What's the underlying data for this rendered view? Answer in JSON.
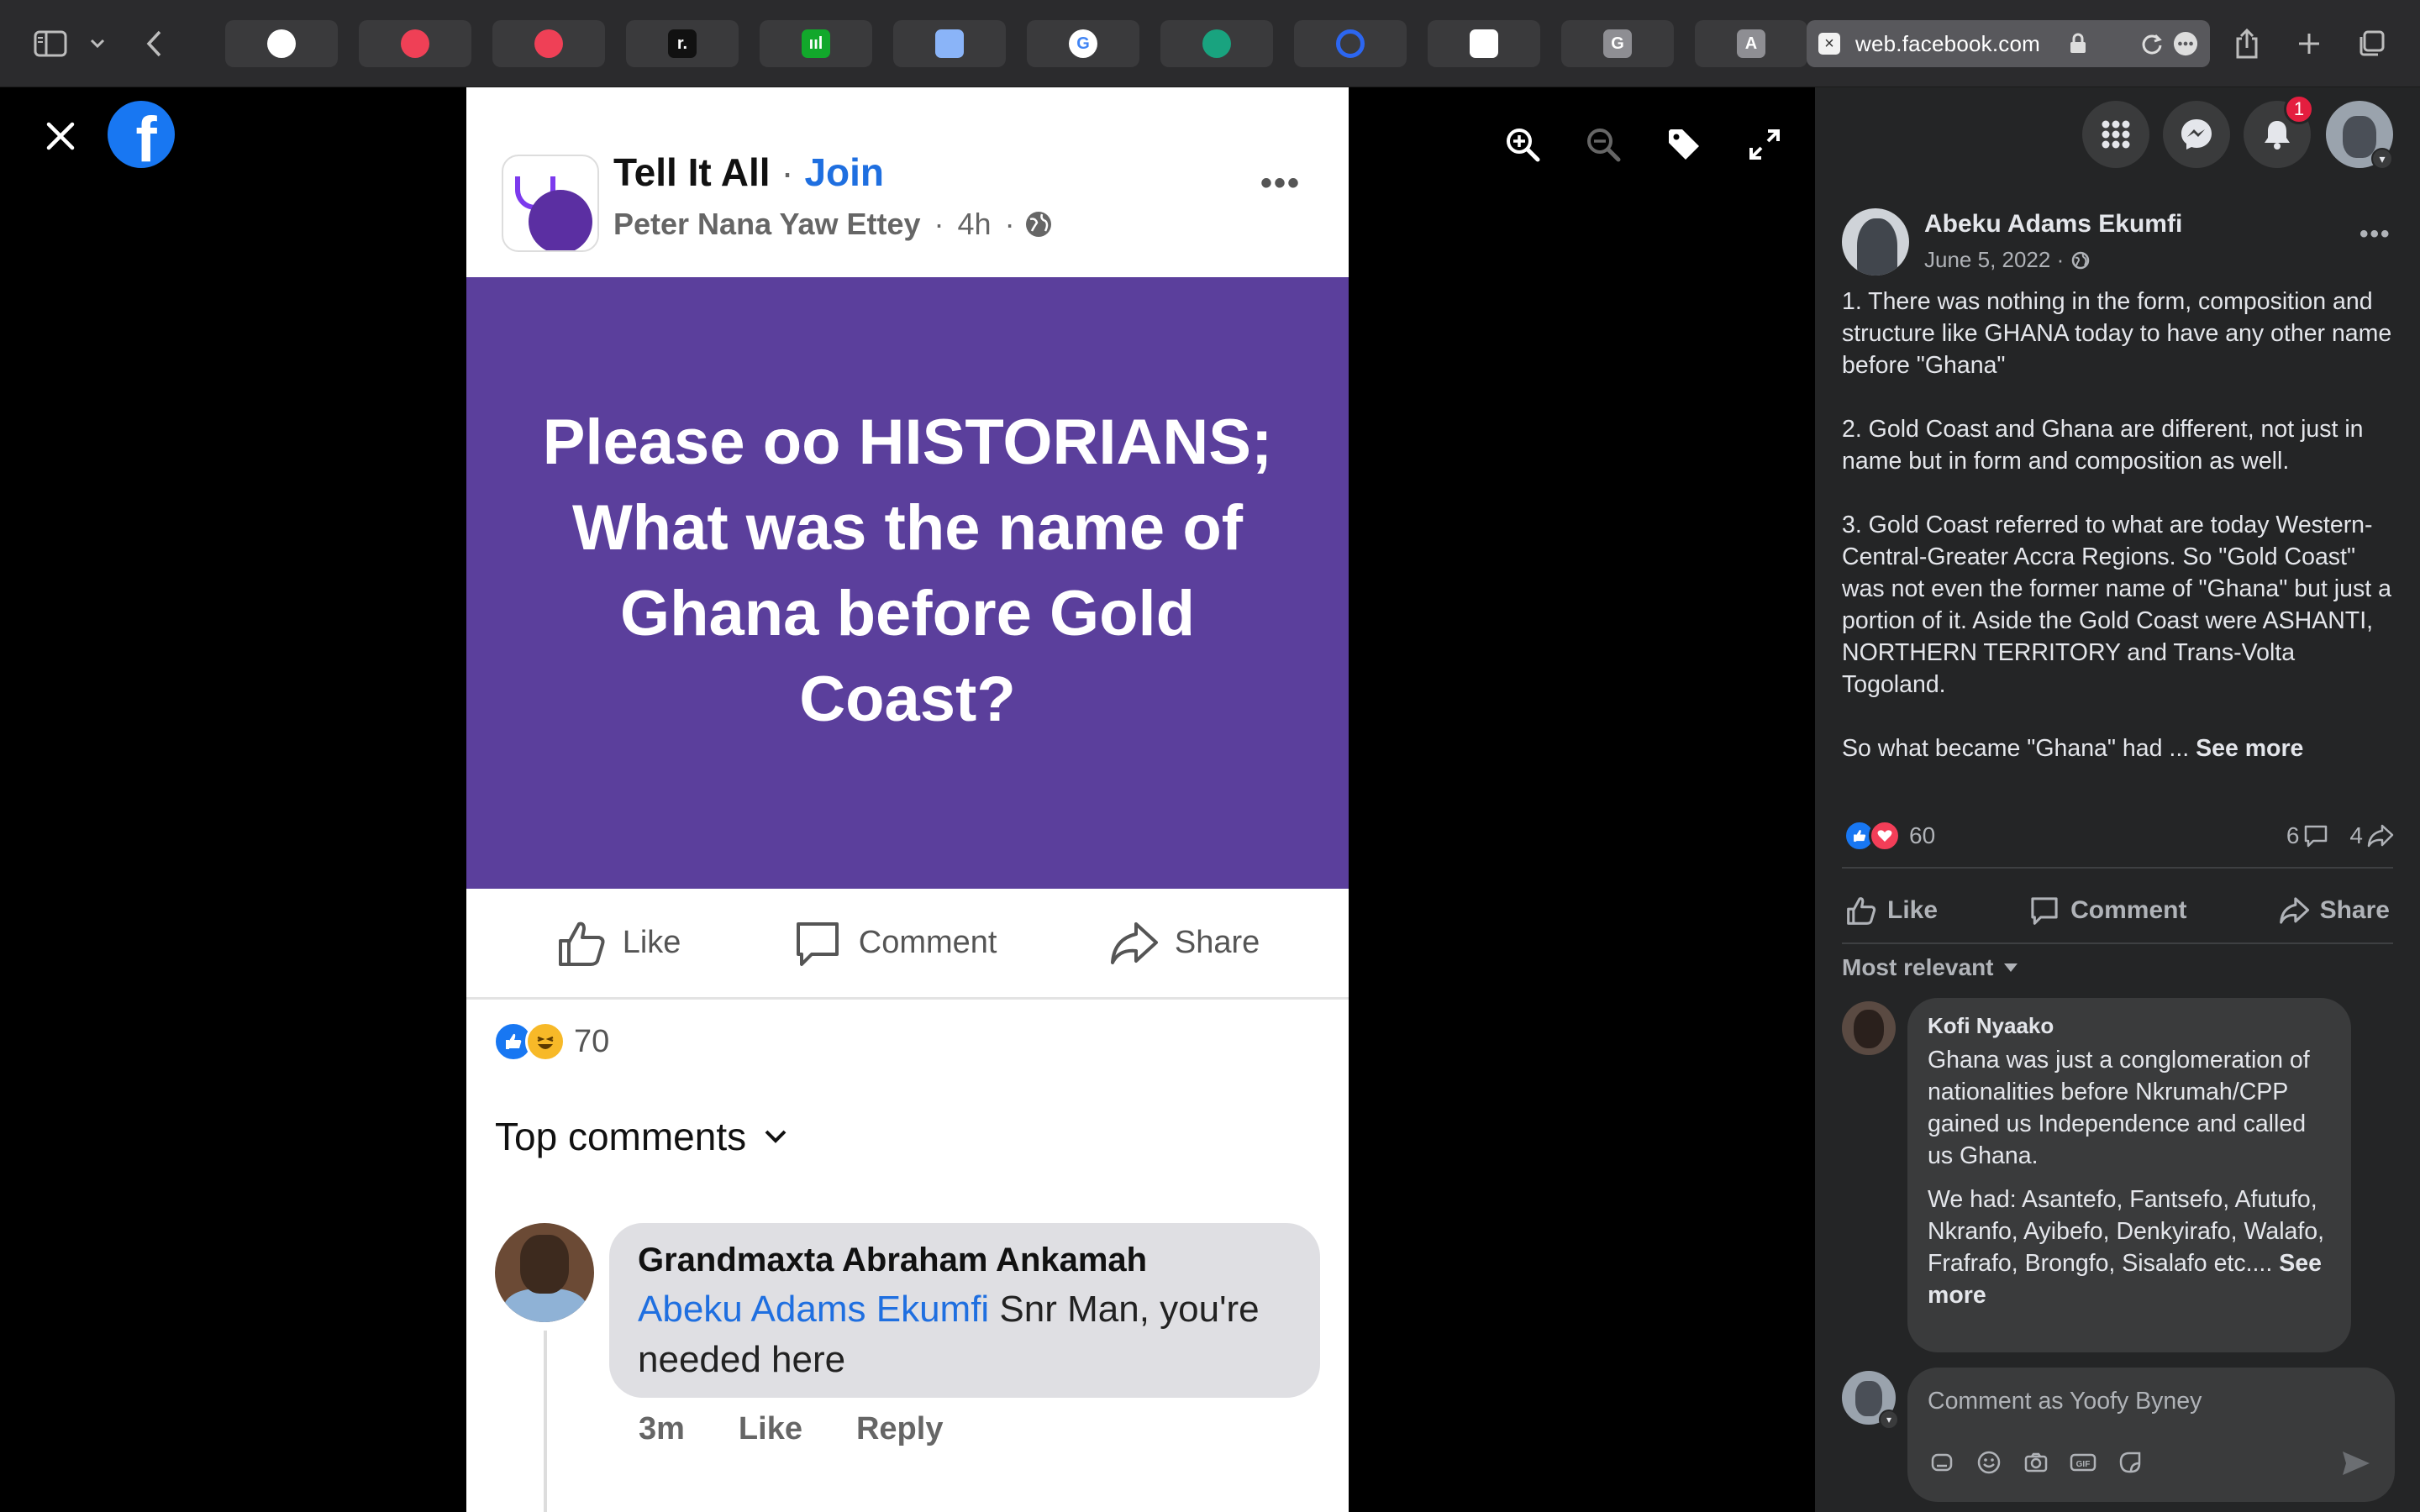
{
  "browser": {
    "url": "web.facebook.com",
    "tabs": [
      {
        "icon": "github-icon",
        "glyph": "",
        "color": "#ffffff"
      },
      {
        "icon": "pocket-icon",
        "glyph": "",
        "color": "#ef4056"
      },
      {
        "icon": "pocket-icon",
        "glyph": "",
        "color": "#ef4056"
      },
      {
        "icon": "readwise-icon",
        "glyph": "r.",
        "color": "#111111"
      },
      {
        "icon": "app-icon",
        "glyph": "ııl",
        "color": "#12a82b"
      },
      {
        "icon": "chat-bubble-icon",
        "glyph": "",
        "color": "#8ab4f8"
      },
      {
        "icon": "google-icon",
        "glyph": "G",
        "color": "#ffffff"
      },
      {
        "icon": "openai-icon",
        "glyph": "",
        "color": "#19a37f"
      },
      {
        "icon": "ring-icon",
        "glyph": "",
        "color": "#2c66f0"
      },
      {
        "icon": "institution-icon",
        "glyph": "",
        "color": "#ffffff"
      },
      {
        "icon": "letter-g-icon",
        "glyph": "G",
        "color": "#8e8e93"
      },
      {
        "icon": "letter-a-icon",
        "glyph": "A",
        "color": "#8e8e93"
      },
      {
        "icon": "whatsapp-icon",
        "glyph": "",
        "color": "#25d366"
      }
    ]
  },
  "photo": {
    "group_name": "Tell It All",
    "join_label": "Join",
    "author": "Peter Nana Yaw Ettey",
    "time": "4h",
    "headline": "Please oo HISTORIANS; What was the name of Ghana before Gold Coast?",
    "like_label": "Like",
    "comment_label": "Comment",
    "share_label": "Share",
    "reaction_count": "70",
    "top_comments_label": "Top comments",
    "comment": {
      "author": "Grandmaxta Abraham Ankamah",
      "mention": "Abeku Adams Ekumfi",
      "text": " Snr Man, you're needed here",
      "time": "3m",
      "like": "Like",
      "reply": "Reply"
    }
  },
  "panel": {
    "notifications_count": "1",
    "author": "Abeku Adams Ekumfi",
    "date": "June 5, 2022 ·",
    "paragraphs": [
      "1. There was nothing in the form, composition and structure like GHANA today to have any other name before \"Ghana\"",
      "2. Gold Coast and Ghana are different, not just in name but in form and composition as well.",
      "3. Gold Coast referred to what are today Western-Central-Greater Accra Regions. So \"Gold Coast\" was not even the former name of \"Ghana\" but just a portion of it. Aside the Gold Coast were ASHANTI, NORTHERN TERRITORY and Trans-Volta Togoland."
    ],
    "last_paragraph": "So what became \"Ghana\" had ... ",
    "see_more": "See more",
    "reactions": "60",
    "comments_count": "6",
    "shares_count": "4",
    "like_label": "Like",
    "comment_label": "Comment",
    "share_label": "Share",
    "sort_label": "Most relevant",
    "comment": {
      "author": "Kofi Nyaako",
      "text1": "Ghana was just a conglomeration of nationalities before Nkrumah/CPP gained us Independence and called us Ghana.",
      "text2": "We had: Asantefo, Fantsefo, Afutufo, Nkranfo, Ayibefo, Denkyirafo, Walafo, Frafrafo, Brongfo, Sisalafo etc.... ",
      "see_more": "See more"
    },
    "comment_placeholder": "Comment as Yoofy Byney"
  }
}
